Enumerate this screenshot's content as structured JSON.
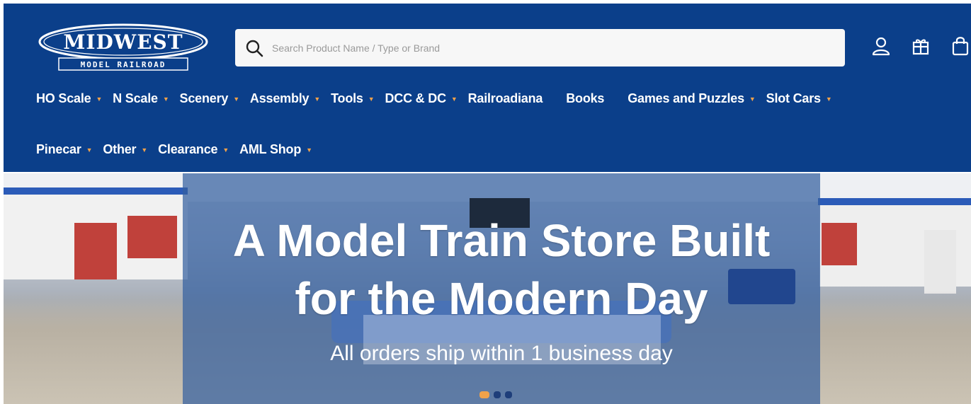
{
  "logo": {
    "brand": "MIDWEST",
    "tagline": "MODEL RAILROAD"
  },
  "search": {
    "placeholder": "Search Product Name / Type or Brand"
  },
  "header_icons": [
    "user-icon",
    "gift-icon",
    "cart-icon"
  ],
  "nav": {
    "row1": [
      {
        "label": "HO Scale",
        "caret": true
      },
      {
        "label": "N Scale",
        "caret": true
      },
      {
        "label": "Scenery",
        "caret": true
      },
      {
        "label": "Assembly",
        "caret": true
      },
      {
        "label": "Tools",
        "caret": true
      },
      {
        "label": "DCC & DC",
        "caret": true
      },
      {
        "label": "Railroadiana",
        "caret": false
      },
      {
        "label": "Books",
        "caret": false
      },
      {
        "label": "Games and Puzzles",
        "caret": true
      },
      {
        "label": "Slot Cars",
        "caret": true
      }
    ],
    "row2": [
      {
        "label": "Pinecar",
        "caret": true
      },
      {
        "label": "Other",
        "caret": true
      },
      {
        "label": "Clearance",
        "caret": true
      },
      {
        "label": "AML Shop",
        "caret": true
      }
    ]
  },
  "hero": {
    "title_line1": "A Model Train Store Built",
    "title_line2": "for the Modern Day",
    "subtitle": "All orders ship within 1 business day"
  },
  "colors": {
    "header_bg": "#0b3f8a",
    "accent": "#f2a24a",
    "overlay": "#3460a0"
  }
}
